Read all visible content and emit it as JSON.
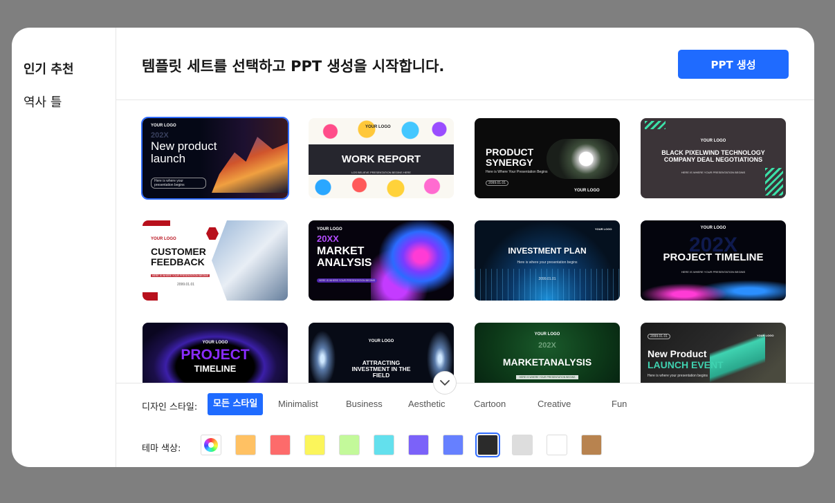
{
  "sidebar": {
    "items": [
      {
        "label": "인기 추천",
        "active": true
      },
      {
        "label": "역사 틀",
        "active": false
      }
    ]
  },
  "header": {
    "title": "템플릿 세트를 선택하고 PPT 생성을 시작합니다.",
    "button": "PPT 생성"
  },
  "templates": [
    {
      "title": "New product launch",
      "logo": "YOUR LOGO",
      "note": "Here is where your presentation begins",
      "year": "202X",
      "selected": true
    },
    {
      "title": "WORK REPORT",
      "logo": "YOUR LOGO",
      "note": "LOS BELIEVE PRESENTATION BEGINS HERE",
      "selected": false
    },
    {
      "title": "PRODUCT SYNERGY",
      "logo": "YOUR LOGO",
      "note": "Here is Where Your Presentation Begins",
      "date": "2099.01.01",
      "selected": false
    },
    {
      "title": "BLACK PIXELWIND TECHNOLOGY COMPANY DEAL NEGOTIATIONS",
      "logo": "YOUR LOGO",
      "note": "HERE IS WHERE YOUR PRESENTATION BEGINS",
      "selected": false
    },
    {
      "title": "CUSTOMER FEEDBACK",
      "logo": "YOUR LOGO",
      "note": "HERE IS WHERE YOUR PRESENTATION BEGINS",
      "date": "2099.01.01",
      "selected": false
    },
    {
      "title": "MARKET ANALYSIS",
      "logo": "YOUR LOGO",
      "year": "20XX",
      "note": "HERE IS WHERE YOUR PRESENTATION BEGINS",
      "selected": false
    },
    {
      "title": "INVESTMENT PLAN",
      "logo": "YOUR LOGO",
      "note": "Here is where your presentation begins",
      "date": "2099.01.01",
      "selected": false
    },
    {
      "title": "PROJECT TIMELINE",
      "logo": "YOUR LOGO",
      "year": "202X",
      "note": "HERE IS WHERE YOUR PRESENTATION BEGINS",
      "selected": false
    },
    {
      "title": "PROJECT",
      "subtitle": "TIMELINE",
      "logo": "YOUR LOGO",
      "selected": false
    },
    {
      "title": "ATTRACTING INVESTMENT IN THE FIELD",
      "logo": "YOUR LOGO",
      "selected": false
    },
    {
      "title": "MARKETANALYSIS",
      "logo": "YOUR LOGO",
      "year": "202X",
      "note": "HERE IS WHERE YOUR PRESENTATION BEGINS",
      "selected": false
    },
    {
      "title": "New Product",
      "subtitle": "LAUNCH EVENT",
      "logo": "YOUR LOGO",
      "date": "2099.01.01",
      "note": "Here is where your presentation begins",
      "selected": false
    }
  ],
  "footer": {
    "style_label": "디자인 스타일:",
    "styles": [
      {
        "label": "모든 스타일",
        "active": true
      },
      {
        "label": "Minimalist",
        "active": false
      },
      {
        "label": "Business",
        "active": false
      },
      {
        "label": "Aesthetic",
        "active": false
      },
      {
        "label": "Cartoon",
        "active": false
      },
      {
        "label": "Creative",
        "active": false
      },
      {
        "label": "Fun",
        "active": false
      }
    ],
    "color_label": "테마 색상:",
    "colors": [
      "rainbow",
      "#ffc163",
      "#fd6b6b",
      "#fbf55b",
      "#c3f99a",
      "#63e0ed",
      "#7b62f9",
      "#6680ff",
      "#2b2b2b",
      "#dddddd",
      "#ffffff",
      "#b8834f"
    ],
    "selected_color_index": 8
  },
  "icons": {
    "scroll": "chevron-down-icon",
    "color_wheel": "color-wheel-icon"
  }
}
